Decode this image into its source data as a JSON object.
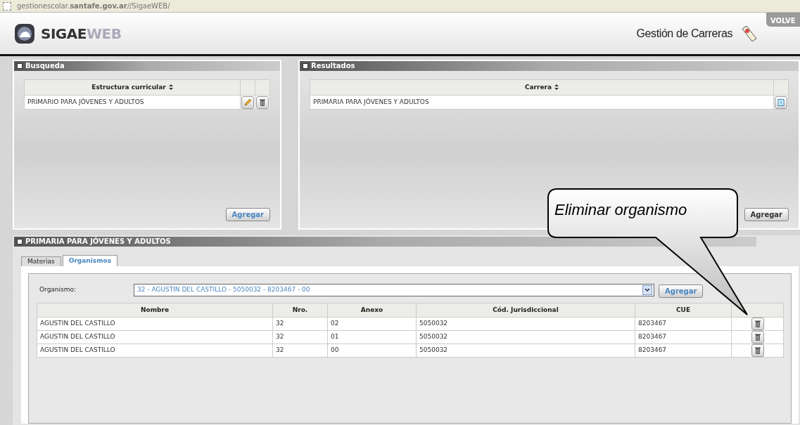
{
  "address_bar": {
    "url": "gestionescolar.**santafe.gov.ar**//SigaeWEB/"
  },
  "header": {
    "logo_primary": "SIGAE",
    "logo_secondary": "WEB",
    "page_title": "Gestión de Carreras",
    "back_tab": "VOLVE"
  },
  "busqueda": {
    "title": "Busqueda",
    "columns": [
      {
        "label": "Estructura curricular",
        "sortable": true
      }
    ],
    "rows": [
      {
        "cells": [
          "PRIMARIO PARA JÓVENES Y ADULTOS"
        ],
        "actions": [
          {
            "kind": "edit"
          },
          {
            "kind": "delete"
          }
        ]
      }
    ],
    "button": {
      "label": "Agregar",
      "active": true
    }
  },
  "resultados": {
    "title": "Resultados",
    "columns": [
      {
        "label": "Carrera",
        "sortable": true
      }
    ],
    "rows": [
      {
        "cells": [
          "PRIMARIA PARA JÓVENES Y ADULTOS"
        ],
        "actions": [
          {
            "kind": "view"
          }
        ]
      }
    ],
    "button": {
      "label": "Agregar",
      "active": false
    }
  },
  "detalle": {
    "title": "PRIMARIA PARA JÓVENES Y ADULTOS",
    "tabs": [
      {
        "label": "Materias",
        "selected": false
      },
      {
        "label": "Organismos",
        "selected": true
      }
    ],
    "organismo_label": "Organismo:",
    "organismo_value": "32 - AGUSTIN DEL CASTILLO - 5050032 - 8203467 - 00",
    "button": {
      "label": "Agregar",
      "active": true
    },
    "columns": [
      "Nombre",
      "Nro.",
      "Anexo",
      "Cód. Jurisdiccional",
      "CUE"
    ],
    "rows": [
      {
        "cells": [
          "AGUSTIN DEL CASTILLO",
          "32",
          "02",
          "5050032",
          "8203467"
        ]
      },
      {
        "cells": [
          "AGUSTIN DEL CASTILLO",
          "32",
          "01",
          "5050032",
          "8203467"
        ]
      },
      {
        "cells": [
          "AGUSTIN DEL CASTILLO",
          "32",
          "00",
          "5050032",
          "8203467"
        ]
      }
    ]
  },
  "callout": {
    "text": "Eliminar organismo"
  }
}
